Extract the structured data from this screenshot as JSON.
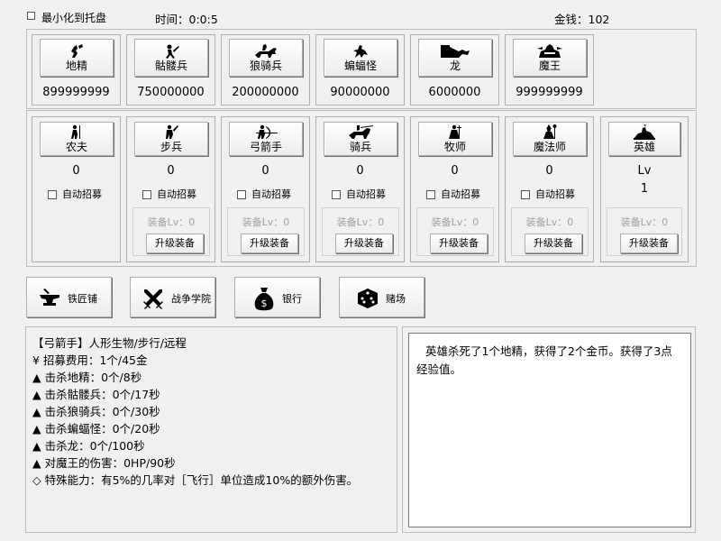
{
  "top": {
    "minimize_label": "最小化到托盘",
    "time_label": "时间：0:0:5",
    "money_label": "金钱：102"
  },
  "enemies": [
    {
      "name": "地精",
      "count": "899999999",
      "icon": "goblin-icon"
    },
    {
      "name": "骷髅兵",
      "count": "750000000",
      "icon": "skeleton-icon"
    },
    {
      "name": "狼骑兵",
      "count": "200000000",
      "icon": "wolf-rider-icon"
    },
    {
      "name": "蝙蝠怪",
      "count": "90000000",
      "icon": "bat-icon"
    },
    {
      "name": "龙",
      "count": "6000000",
      "icon": "dragon-icon"
    },
    {
      "name": "魔王",
      "count": "999999999",
      "icon": "demon-king-icon"
    }
  ],
  "units": [
    {
      "name": "农夫",
      "count": "0",
      "auto": "自动招募",
      "icon": "farmer-icon"
    },
    {
      "name": "步兵",
      "count": "0",
      "auto": "自动招募",
      "equip_lv": "装备Lv：0",
      "upgrade": "升级装备",
      "icon": "infantry-icon"
    },
    {
      "name": "弓箭手",
      "count": "0",
      "auto": "自动招募",
      "equip_lv": "装备Lv：0",
      "upgrade": "升级装备",
      "icon": "archer-icon"
    },
    {
      "name": "骑兵",
      "count": "0",
      "auto": "自动招募",
      "equip_lv": "装备Lv：0",
      "upgrade": "升级装备",
      "icon": "cavalry-icon"
    },
    {
      "name": "牧师",
      "count": "0",
      "auto": "自动招募",
      "equip_lv": "装备Lv：0",
      "upgrade": "升级装备",
      "icon": "priest-icon"
    },
    {
      "name": "魔法师",
      "count": "0",
      "auto": "自动招募",
      "equip_lv": "装备Lv：0",
      "upgrade": "升级装备",
      "icon": "mage-icon"
    }
  ],
  "hero": {
    "name": "英雄",
    "lv_label": "Lv",
    "lv_value": "1",
    "equip_lv": "装备Lv：0",
    "upgrade": "升级装备",
    "icon": "hero-icon"
  },
  "nav": [
    {
      "label": "铁匠铺",
      "icon": "anvil-icon"
    },
    {
      "label": "战争学院",
      "icon": "crossed-swords-icon"
    },
    {
      "label": "银行",
      "icon": "money-bag-icon"
    },
    {
      "label": "赌场",
      "icon": "dice-icon"
    }
  ],
  "info": {
    "title": "【弓箭手】人形生物/步行/远程",
    "lines": [
      "¥ 招募费用：1个/45金",
      "▲ 击杀地精：0个/8秒",
      "▲ 击杀骷髅兵：0个/17秒",
      "▲ 击杀狼骑兵：0个/30秒",
      "▲ 击杀蝙蝠怪：0个/20秒",
      "▲ 击杀龙：0个/100秒",
      "▲ 对魔王的伤害：0HP/90秒",
      "◇ 特殊能力：有5%的几率对［飞行］单位造成10%的额外伤害。"
    ]
  },
  "log": {
    "text": "英雄杀死了1个地精，获得了2个金币。获得了3点经验值。"
  }
}
